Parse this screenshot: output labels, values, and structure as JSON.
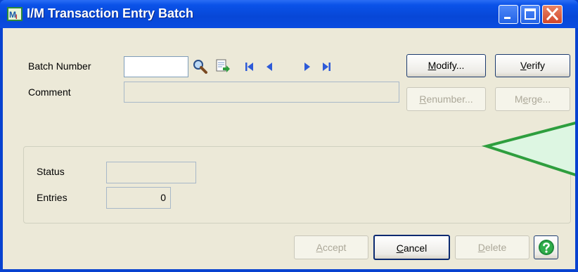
{
  "window": {
    "title": "I/M Transaction Entry Batch"
  },
  "form": {
    "batch_number_label": "Batch Number",
    "batch_number_value": "",
    "comment_label": "Comment",
    "comment_value": ""
  },
  "buttons": {
    "modify": {
      "prefix": "",
      "u": "M",
      "rest": "odify..."
    },
    "verify": {
      "prefix": "",
      "u": "V",
      "rest": "erify"
    },
    "renumber": {
      "prefix": "",
      "u": "R",
      "rest": "enumber..."
    },
    "merge": {
      "prefix": "M",
      "u": "e",
      "rest": "rge..."
    },
    "accept": {
      "prefix": "",
      "u": "A",
      "rest": "ccept"
    },
    "cancel": {
      "prefix": "",
      "u": "C",
      "rest": "ancel"
    },
    "delete": {
      "prefix": "",
      "u": "D",
      "rest": "elete"
    }
  },
  "status_group": {
    "status_label": "Status",
    "status_value": "",
    "entries_label": "Entries",
    "entries_value": "0"
  },
  "icons": [
    "app-icon",
    "search-icon",
    "new-batch-icon",
    "first-record-icon",
    "previous-record-icon",
    "next-record-icon",
    "last-record-icon",
    "help-icon",
    "minimize-icon",
    "maximize-icon",
    "close-icon"
  ],
  "colors": {
    "titlebar": "#0a52e8",
    "client": "#ece9d8",
    "callout_border": "#2e9e3e",
    "callout_fill": "#ddf6e2"
  }
}
